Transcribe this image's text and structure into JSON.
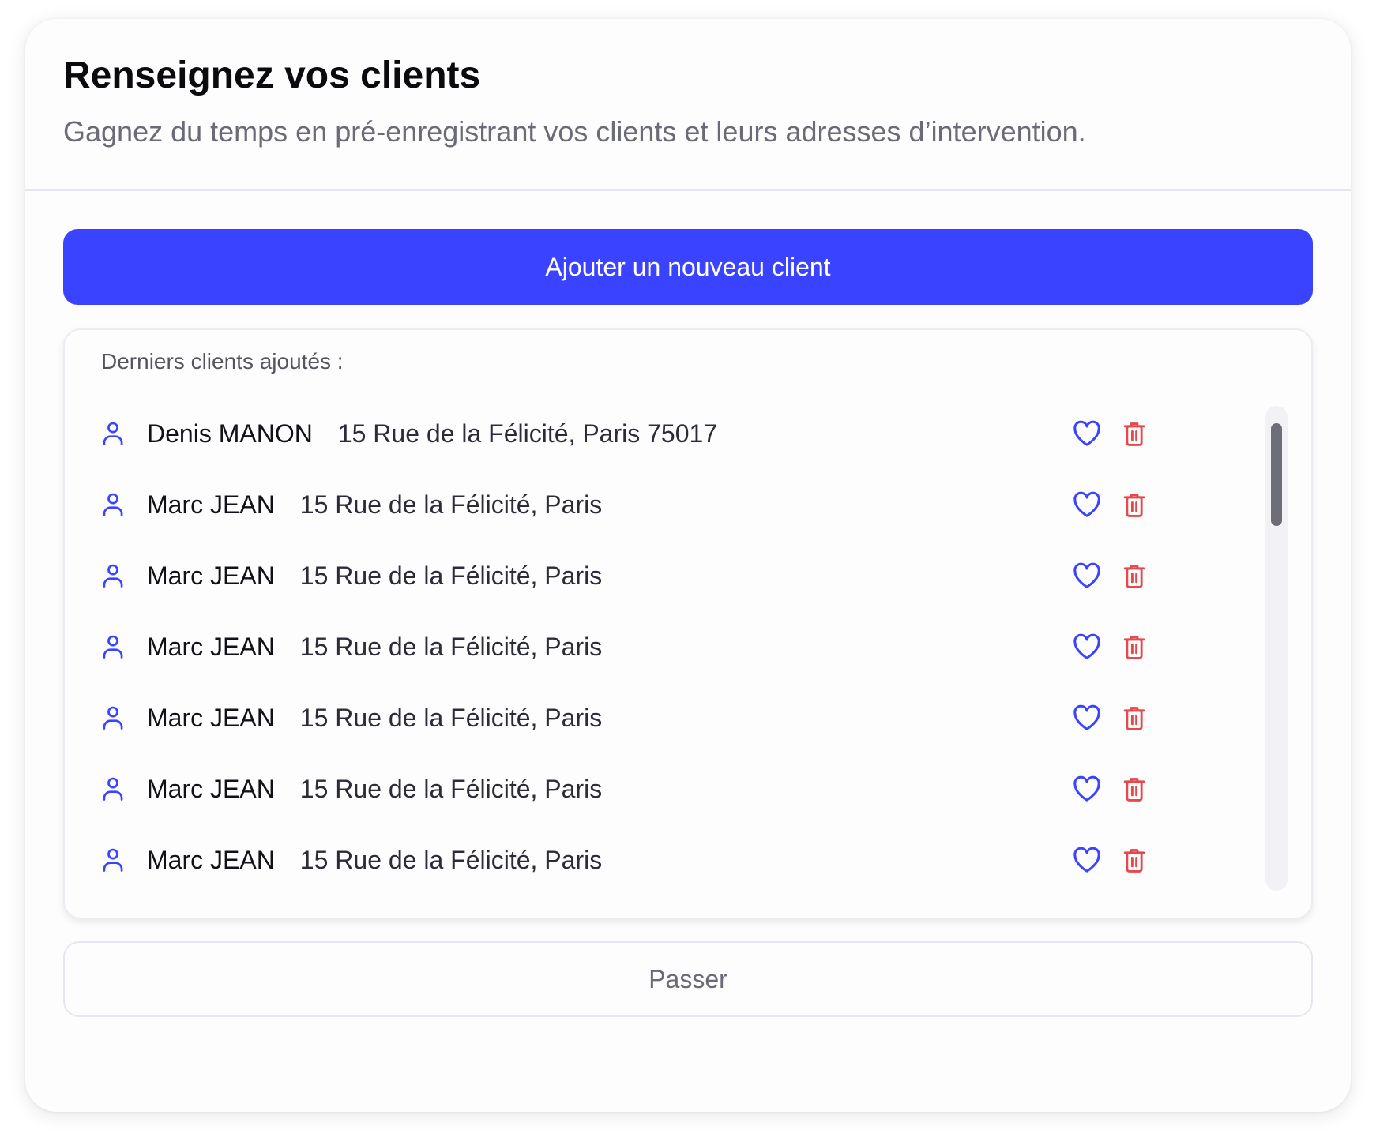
{
  "header": {
    "title": "Renseignez vos clients",
    "subtitle": "Gagnez du temps en pré-enregistrant vos clients et leurs adresses d’intervention."
  },
  "actions": {
    "add_label": "Ajouter un nouveau client",
    "skip_label": "Passer"
  },
  "list": {
    "heading": "Derniers clients ajoutés :",
    "clients": [
      {
        "name": "Denis MANON",
        "address": "15 Rue de la Félicité, Paris 75017"
      },
      {
        "name": "Marc JEAN",
        "address": "15 Rue de la Félicité, Paris"
      },
      {
        "name": "Marc JEAN",
        "address": "15 Rue de la Félicité, Paris"
      },
      {
        "name": "Marc JEAN",
        "address": "15 Rue de la Félicité, Paris"
      },
      {
        "name": "Marc JEAN",
        "address": "15 Rue de la Félicité, Paris"
      },
      {
        "name": "Marc JEAN",
        "address": "15 Rue de la Félicité, Paris"
      },
      {
        "name": "Marc JEAN",
        "address": "15 Rue de la Félicité, Paris"
      }
    ]
  },
  "icons": {
    "user": "user-icon",
    "favorite": "heart-icon",
    "delete": "trash-icon"
  },
  "colors": {
    "primary": "#3a43ff",
    "danger": "#e5484d",
    "muted_text": "#6b6b78"
  }
}
